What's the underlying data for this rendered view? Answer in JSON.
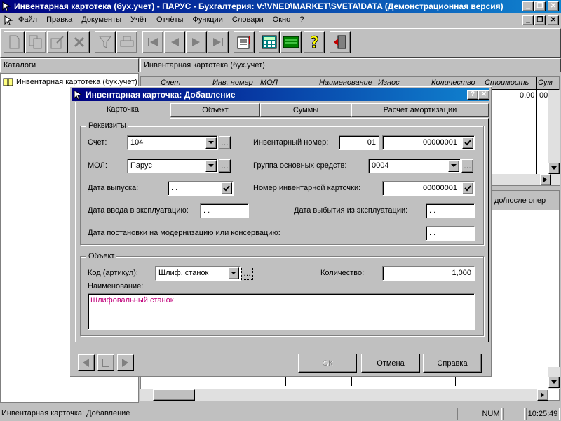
{
  "window": {
    "title": "Инвентарная картотека (бух.учет) - ПАРУС - Бухгалтерия: V:\\VNED\\MARKET\\SVETA\\DATA (Демонстрационная версия)"
  },
  "menu": [
    "Файл",
    "Правка",
    "Документы",
    "Учёт",
    "Отчёты",
    "Функции",
    "Словари",
    "Окно",
    "?"
  ],
  "left_panel": {
    "title": "Каталоги",
    "item": "Инвентарная картотека (бух.учет)"
  },
  "right_panel": {
    "title": "Инвентарная картотека (бух.учет)",
    "columns": [
      "Счет",
      "Инв. номер",
      "МОЛ",
      "Наименование",
      "Износ",
      "Количество",
      "Стоимость",
      "Сум"
    ],
    "row_values": [
      "0,00",
      "00"
    ],
    "lower_header": "до/после опер"
  },
  "dialog": {
    "title": "Инвентарная карточка: Добавление",
    "tabs": [
      "Карточка",
      "Объект",
      "Суммы",
      "Расчет амортизации"
    ],
    "requisites": {
      "title": "Реквизиты",
      "account_label": "Счет:",
      "account_value": "104",
      "inv_label": "Инвентарный номер:",
      "inv_prefix": "01",
      "inv_number": "00000001",
      "mol_label": "МОЛ:",
      "mol_value": "Парус",
      "group_label": "Группа основных средств:",
      "group_value": "0004",
      "release_label": "Дата выпуска:",
      "release_value": " . .",
      "card_label": "Номер инвентарной карточки:",
      "card_value": "00000001",
      "commission_label": "Дата ввода в эксплуатацию:",
      "commission_value": " .  .",
      "retire_label": "Дата выбытия из эксплуатации:",
      "retire_value": " .  .",
      "modern_label": "Дата постановки на модернизацию или консервацию:",
      "modern_value": " .  ."
    },
    "object": {
      "title": "Объект",
      "code_label": "Код (артикул):",
      "code_value": "Шлиф. станок",
      "qty_label": "Количество:",
      "qty_value": "1,000",
      "name_label": "Наименование:",
      "name_value": "Шлифовальный станок"
    },
    "buttons": {
      "ok": "ОК",
      "cancel": "Отмена",
      "help": "Справка"
    }
  },
  "status": {
    "text": "Инвентарная карточка: Добавление",
    "num": "NUM",
    "time": "10:25:49"
  },
  "colors": {
    "title_start": "#000080",
    "title_end": "#1084d0",
    "name_text": "#c0007a"
  }
}
